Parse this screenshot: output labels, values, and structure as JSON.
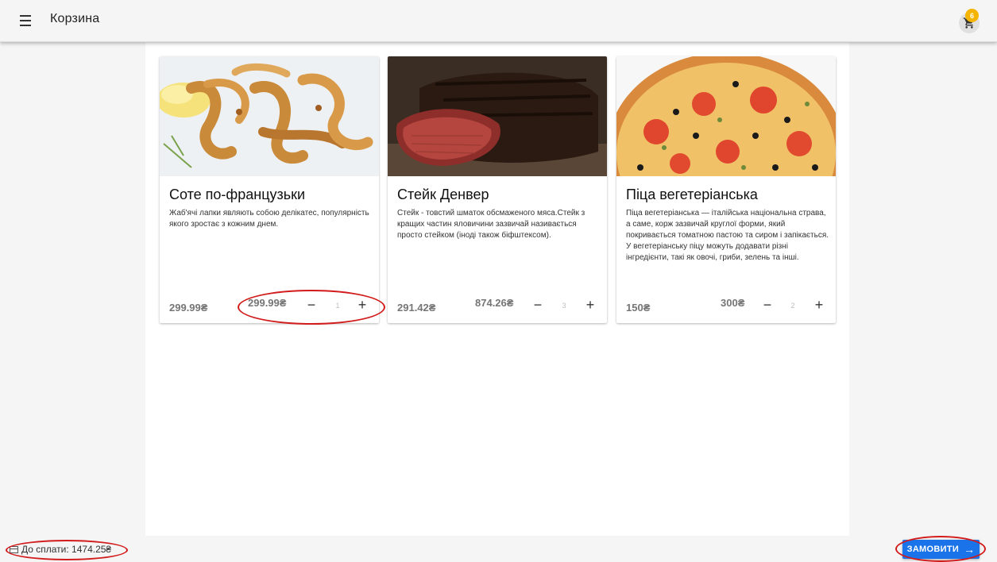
{
  "header": {
    "title": "Корзина",
    "cart_count": "6"
  },
  "products": [
    {
      "title": "Соте по-французьки",
      "description": "Жаб'ячі лапки являють собою делікатес, популярність якого зростає з кожним днем.",
      "price": "299.99₴",
      "total": "299.99₴",
      "quantity": "1",
      "minus": "−",
      "plus": "+",
      "image_icon": "fried-frog-legs-image"
    },
    {
      "title": "Стейк Денвер",
      "description": "Стейк - товстий шматок обсмаженого мяса.Стейк з кращих частин яловичини зазвичай називається просто стейком (іноді також біфштексом).",
      "price": "291.42₴",
      "total": "874.26₴",
      "quantity": "3",
      "minus": "−",
      "plus": "+",
      "image_icon": "steak-image"
    },
    {
      "title": "Піца вегетеріанська",
      "description": "Піца вегетеріанська — італійська національна страва, а саме, корж зазвичай круглої форми, який покривається томатною пастою та сиром і запікається. У вегетеріанську піцу можуть додавати різні інгредієнти, такі як овочі, гриби, зелень та інші.",
      "price": "150₴",
      "total": "300₴",
      "quantity": "2",
      "minus": "−",
      "plus": "+",
      "image_icon": "pizza-image"
    }
  ],
  "footer": {
    "payment_label": "До сплати: 1474.25₴",
    "order_button": "ЗАМОВИТИ",
    "order_arrow": "→"
  },
  "colors": {
    "accent": "#1a73e8",
    "badge": "#f4b400",
    "annotation": "#d21b1b"
  }
}
